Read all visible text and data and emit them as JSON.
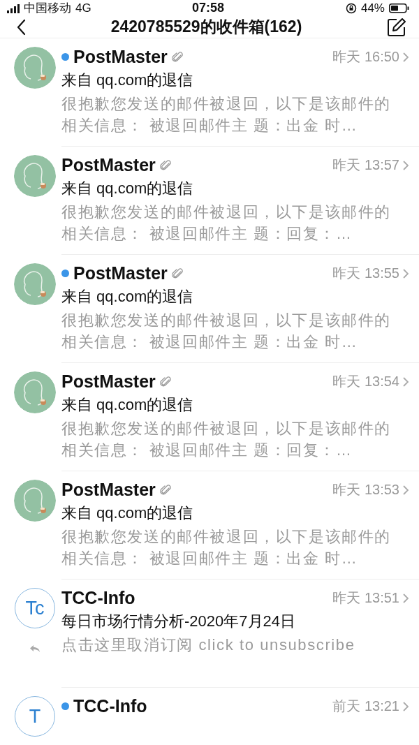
{
  "status_bar": {
    "carrier": "中国移动",
    "network": "4G",
    "time": "07:58",
    "battery": "44%"
  },
  "header": {
    "title": "2420785529的收件箱(162)"
  },
  "messages": [
    {
      "avatar": {
        "kind": "figure"
      },
      "unread": true,
      "attachment": true,
      "replied": false,
      "sender": "PostMaster",
      "time": "昨天 16:50",
      "subject": "来自 qq.com的退信",
      "preview": "很抱歉您发送的邮件被退回，以下是该邮件的相关信息： 被退回邮件主 题：出金 时…"
    },
    {
      "avatar": {
        "kind": "figure"
      },
      "unread": false,
      "attachment": true,
      "replied": false,
      "sender": "PostMaster",
      "time": "昨天 13:57",
      "subject": "来自 qq.com的退信",
      "preview": "很抱歉您发送的邮件被退回，以下是该邮件的相关信息： 被退回邮件主 题：回复：…"
    },
    {
      "avatar": {
        "kind": "figure"
      },
      "unread": true,
      "attachment": true,
      "replied": false,
      "sender": "PostMaster",
      "time": "昨天 13:55",
      "subject": "来自 qq.com的退信",
      "preview": "很抱歉您发送的邮件被退回，以下是该邮件的相关信息： 被退回邮件主 题：出金 时…"
    },
    {
      "avatar": {
        "kind": "figure"
      },
      "unread": false,
      "attachment": true,
      "replied": false,
      "sender": "PostMaster",
      "time": "昨天 13:54",
      "subject": "来自 qq.com的退信",
      "preview": "很抱歉您发送的邮件被退回，以下是该邮件的相关信息： 被退回邮件主 题：回复：…"
    },
    {
      "avatar": {
        "kind": "figure"
      },
      "unread": false,
      "attachment": true,
      "replied": false,
      "sender": "PostMaster",
      "time": "昨天 13:53",
      "subject": "来自 qq.com的退信",
      "preview": "很抱歉您发送的邮件被退回，以下是该邮件的相关信息： 被退回邮件主 题：出金 时…"
    },
    {
      "avatar": {
        "kind": "initials",
        "text": "Tc"
      },
      "unread": false,
      "attachment": false,
      "replied": true,
      "sender": "TCC-Info",
      "time": "昨天 13:51",
      "subject": "每日市场行情分析-2020年7月24日",
      "preview": "点击这里取消订阅 click to unsubscribe"
    },
    {
      "avatar": {
        "kind": "initials",
        "text": "T"
      },
      "unread": true,
      "attachment": false,
      "replied": false,
      "sender": "TCC-Info",
      "time": "前天 13:21"
    }
  ]
}
